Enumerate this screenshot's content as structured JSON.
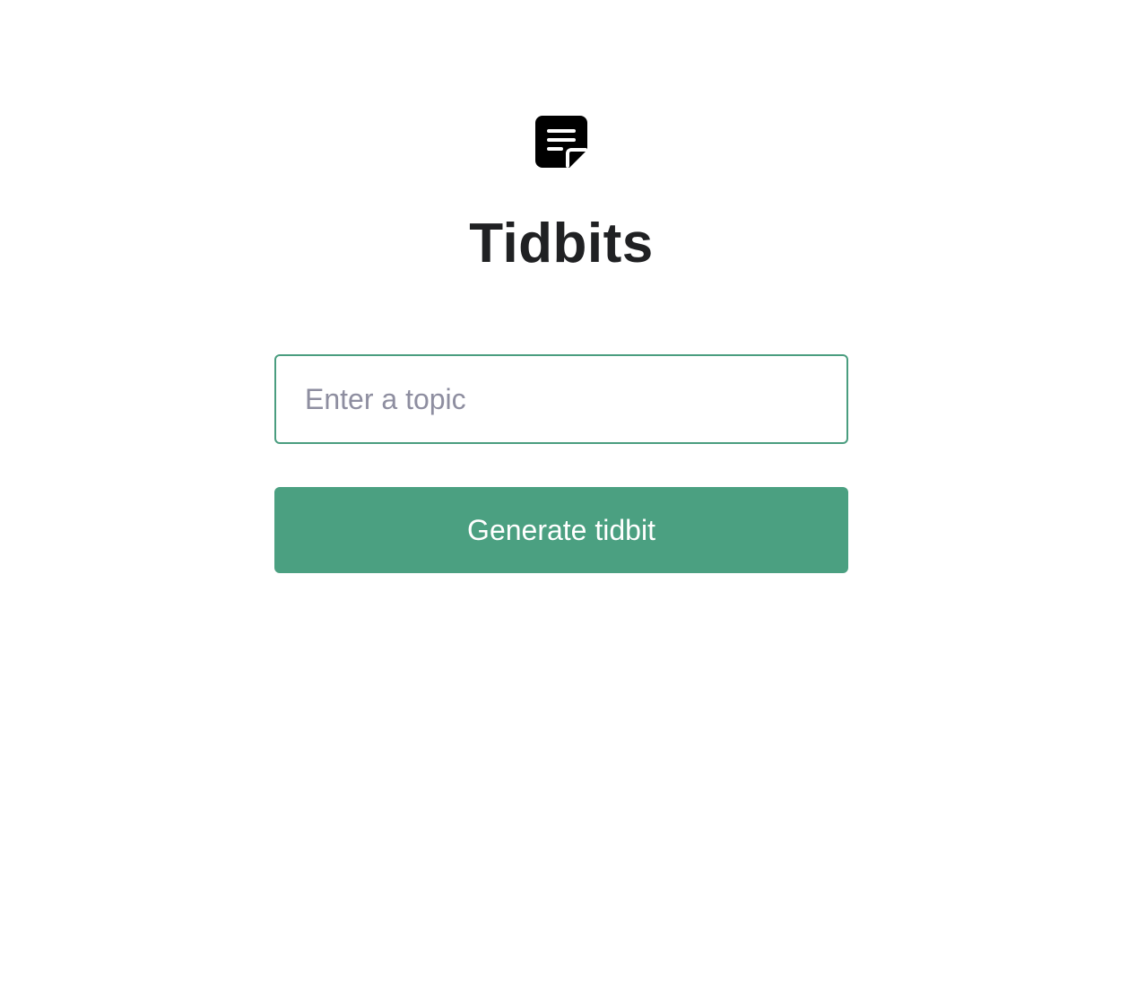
{
  "app": {
    "logo_icon": "note-edit-icon",
    "title": "Tidbits"
  },
  "form": {
    "topic_placeholder": "Enter a topic",
    "topic_value": "",
    "submit_label": "Generate tidbit"
  },
  "colors": {
    "accent": "#4ba081",
    "input_border": "#4a9d7f",
    "title_text": "#202123",
    "placeholder_text": "#8e8ea0",
    "logo": "#000000"
  }
}
